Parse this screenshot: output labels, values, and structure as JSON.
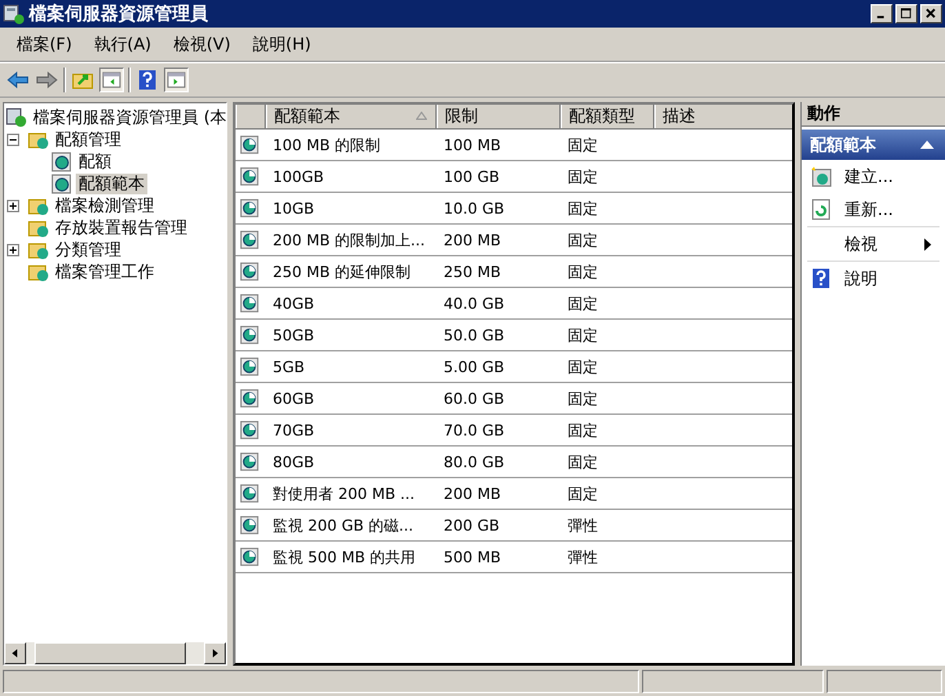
{
  "window": {
    "title": "檔案伺服器資源管理員"
  },
  "menu": [
    "檔案(F)",
    "執行(A)",
    "檢視(V)",
    "說明(H)"
  ],
  "tree": {
    "label": "檔案伺服器資源管理員 (本",
    "children": [
      {
        "label": "配額管理",
        "expanded": true,
        "selected": false,
        "children": [
          {
            "label": "配額",
            "selected": false
          },
          {
            "label": "配額範本",
            "selected": true
          }
        ]
      },
      {
        "label": "檔案檢測管理",
        "expanded": false,
        "selected": false
      },
      {
        "label": "存放裝置報告管理",
        "selected": false
      },
      {
        "label": "分類管理",
        "expanded": false,
        "selected": false
      },
      {
        "label": "檔案管理工作",
        "selected": false
      }
    ]
  },
  "table": {
    "columns": [
      {
        "label": "配額範本",
        "sorted": true
      },
      {
        "label": "限制",
        "sorted": false
      },
      {
        "label": "配額類型",
        "sorted": false
      },
      {
        "label": "描述",
        "sorted": false
      }
    ],
    "rows": [
      {
        "name": "100 MB 的限制",
        "limit": "100 MB",
        "type": "固定"
      },
      {
        "name": "100GB",
        "limit": "100 GB",
        "type": "固定"
      },
      {
        "name": "10GB",
        "limit": "10.0 GB",
        "type": "固定"
      },
      {
        "name": "200 MB 的限制加上...",
        "limit": "200 MB",
        "type": "固定"
      },
      {
        "name": "250 MB 的延伸限制",
        "limit": "250 MB",
        "type": "固定"
      },
      {
        "name": "40GB",
        "limit": "40.0 GB",
        "type": "固定"
      },
      {
        "name": "50GB",
        "limit": "50.0 GB",
        "type": "固定"
      },
      {
        "name": "5GB",
        "limit": "5.00 GB",
        "type": "固定"
      },
      {
        "name": "60GB",
        "limit": "60.0 GB",
        "type": "固定"
      },
      {
        "name": "70GB",
        "limit": "70.0 GB",
        "type": "固定"
      },
      {
        "name": "80GB",
        "limit": "80.0 GB",
        "type": "固定"
      },
      {
        "name": "對使用者 200 MB ...",
        "limit": "200 MB",
        "type": "固定"
      },
      {
        "name": "監視 200 GB 的磁...",
        "limit": "200 GB",
        "type": "彈性"
      },
      {
        "name": "監視 500 MB 的共用",
        "limit": "500 MB",
        "type": "彈性"
      }
    ]
  },
  "actions": {
    "title": "動作",
    "section": {
      "label": "配額範本",
      "expanded": true
    },
    "items": [
      {
        "label": "建立...",
        "kind": "new"
      },
      {
        "label": "重新...",
        "kind": "refresh"
      },
      {
        "label": "檢視",
        "kind": "submenu"
      },
      {
        "label": "說明",
        "kind": "help"
      }
    ]
  }
}
